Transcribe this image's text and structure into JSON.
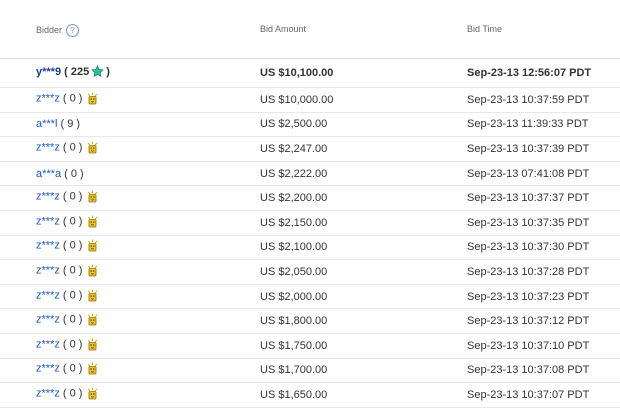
{
  "header": {
    "bidder": "Bidder",
    "help_glyph": "?",
    "bid_amount": "Bid Amount",
    "bid_time": "Bid Time"
  },
  "rows": [
    {
      "bidder": "y***9",
      "score": "225",
      "amount": "US $10,100.00",
      "time": "Sep-23-13 12:56:07 PDT",
      "icon": "star-icon"
    },
    {
      "bidder": "z***z",
      "score": "0",
      "amount": "US $10,000.00",
      "time": "Sep-23-13 10:37:59 PDT",
      "icon": "new-member-icon"
    },
    {
      "bidder": "a***l",
      "score": "9",
      "amount": "US $2,500.00",
      "time": "Sep-23-13 11:39:33 PDT",
      "icon": ""
    },
    {
      "bidder": "z***z",
      "score": "0",
      "amount": "US $2,247.00",
      "time": "Sep-23-13 10:37:39 PDT",
      "icon": "new-member-icon"
    },
    {
      "bidder": "a***a",
      "score": "0",
      "amount": "US $2,222.00",
      "time": "Sep-23-13 07:41:08 PDT",
      "icon": ""
    },
    {
      "bidder": "z***z",
      "score": "0",
      "amount": "US $2,200.00",
      "time": "Sep-23-13 10:37:37 PDT",
      "icon": "new-member-icon"
    },
    {
      "bidder": "z***z",
      "score": "0",
      "amount": "US $2,150.00",
      "time": "Sep-23-13 10:37:35 PDT",
      "icon": "new-member-icon"
    },
    {
      "bidder": "z***z",
      "score": "0",
      "amount": "US $2,100.00",
      "time": "Sep-23-13 10:37:30 PDT",
      "icon": "new-member-icon"
    },
    {
      "bidder": "z***z",
      "score": "0",
      "amount": "US $2,050.00",
      "time": "Sep-23-13 10:37:28 PDT",
      "icon": "new-member-icon"
    },
    {
      "bidder": "z***z",
      "score": "0",
      "amount": "US $2,000.00",
      "time": "Sep-23-13 10:37:23 PDT",
      "icon": "new-member-icon"
    },
    {
      "bidder": "z***z",
      "score": "0",
      "amount": "US $1,800.00",
      "time": "Sep-23-13 10:37:12 PDT",
      "icon": "new-member-icon"
    },
    {
      "bidder": "z***z",
      "score": "0",
      "amount": "US $1,750.00",
      "time": "Sep-23-13 10:37:10 PDT",
      "icon": "new-member-icon"
    },
    {
      "bidder": "z***z",
      "score": "0",
      "amount": "US $1,700.00",
      "time": "Sep-23-13 10:37:08 PDT",
      "icon": "new-member-icon"
    },
    {
      "bidder": "z***z",
      "score": "0",
      "amount": "US $1,650.00",
      "time": "Sep-23-13 10:37:07 PDT",
      "icon": "new-member-icon"
    }
  ],
  "colors": {
    "bidder_link": "#1a55c9",
    "star": "#2bbf9c",
    "new_member_icon": "#e0a800"
  }
}
